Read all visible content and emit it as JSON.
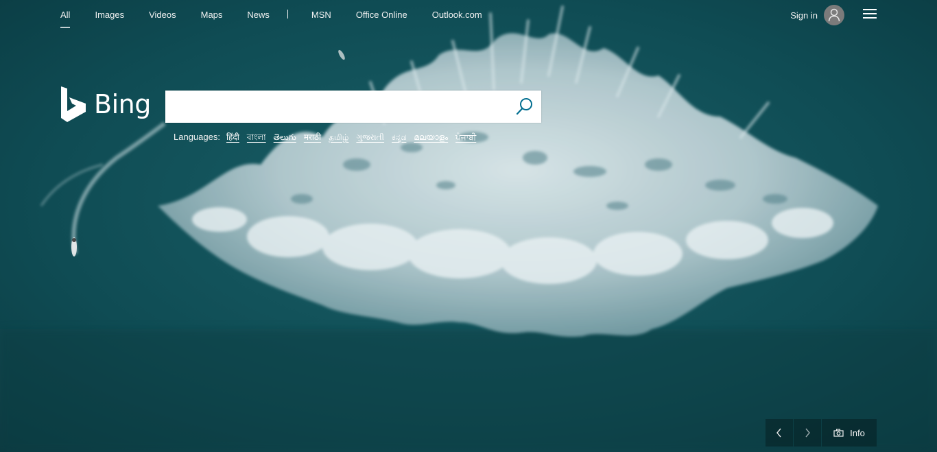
{
  "nav": {
    "items": [
      {
        "label": "All",
        "active": true
      },
      {
        "label": "Images"
      },
      {
        "label": "Videos"
      },
      {
        "label": "Maps"
      },
      {
        "label": "News"
      }
    ],
    "external": [
      {
        "label": "MSN"
      },
      {
        "label": "Office Online"
      },
      {
        "label": "Outlook.com"
      }
    ]
  },
  "account": {
    "signin_label": "Sign in",
    "avatar_icon": "person-icon"
  },
  "menu_icon": "hamburger-menu-icon",
  "logo": {
    "word": "Bing",
    "icon": "bing-b-logo-icon"
  },
  "search": {
    "value": "",
    "placeholder": "",
    "button_icon": "search-icon",
    "button_color": "#006d8f"
  },
  "languages": {
    "label": "Languages:",
    "items": [
      "हिंदी",
      "বাংলা",
      "తెలుగు",
      "मराठी",
      "தமிழ்",
      "ગુજરાતી",
      "ಕನ್ನಡ",
      "മലയാളം",
      "ਪੰਜਾਬੀ"
    ]
  },
  "bottom": {
    "prev_icon": "chevron-left-icon",
    "next_icon": "chevron-right-icon",
    "info_label": "Info",
    "camera_icon": "camera-icon"
  },
  "background": {
    "description_colors": {
      "ocean": "#0f4a52",
      "foam": "#d8e6ea"
    }
  }
}
